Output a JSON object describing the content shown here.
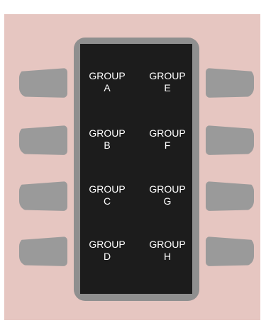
{
  "groups_left": [
    {
      "line1": "GROUP",
      "line2": "A"
    },
    {
      "line1": "GROUP",
      "line2": "B"
    },
    {
      "line1": "GROUP",
      "line2": "C"
    },
    {
      "line1": "GROUP",
      "line2": "D"
    }
  ],
  "groups_right": [
    {
      "line1": "GROUP",
      "line2": "E"
    },
    {
      "line1": "GROUP",
      "line2": "F"
    },
    {
      "line1": "GROUP",
      "line2": "G"
    },
    {
      "line1": "GROUP",
      "line2": "H"
    }
  ],
  "colors": {
    "panel": "#e6c6c1",
    "frame": "#8f8f8f",
    "screen": "#1c1c1c",
    "button": "#9a9a9a",
    "text": "#ffffff"
  }
}
